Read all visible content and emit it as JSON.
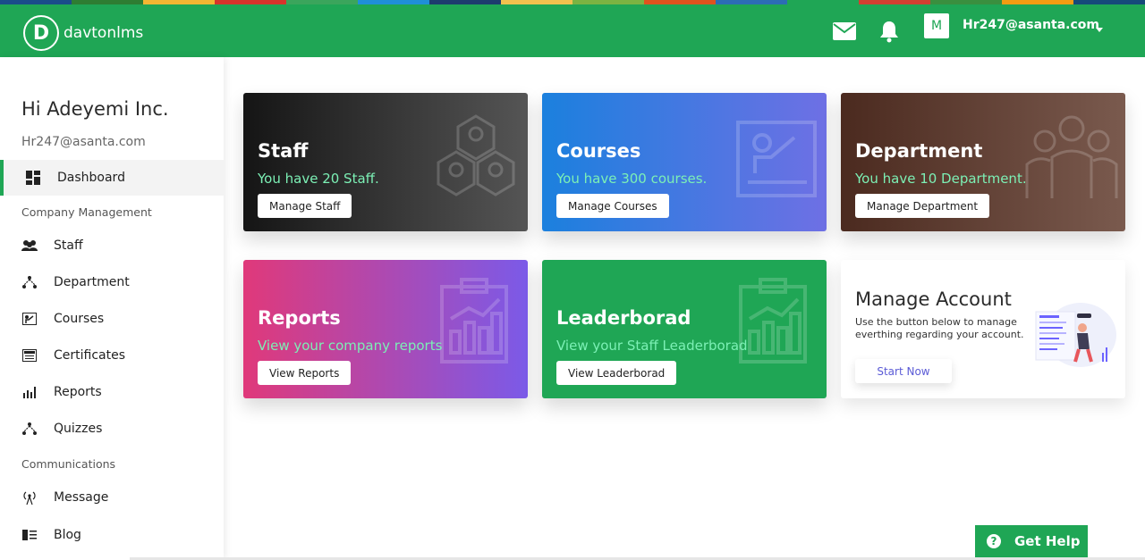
{
  "colors": {
    "brand_green": "#1fa655",
    "stripe": [
      "#1a4c8a",
      "#2e7d32",
      "#f2b632",
      "#d7342b",
      "#3ba55c",
      "#1f8fd8",
      "#1d3c6e",
      "#f2c14e",
      "#7bb342",
      "#e0521e",
      "#2c6db5",
      "#1fa655",
      "#d23f31",
      "#3a8f3f",
      "#f39c12",
      "#164a7a"
    ]
  },
  "header": {
    "logo_letter": "D",
    "logo_text": "davtonlms",
    "icons": [
      "mail-icon",
      "bell-icon"
    ],
    "avatar_letter": "M",
    "user_email": "Hr247@asanta.com"
  },
  "sidebar": {
    "greeting": "Hi Adeyemi Inc.",
    "email": "Hr247@asanta.com",
    "dashboard": {
      "label": "Dashboard",
      "icon": "dashboard-icon"
    },
    "sections": [
      {
        "title": "Company Management",
        "items": [
          {
            "label": "Staff",
            "icon": "users-icon"
          },
          {
            "label": "Department",
            "icon": "hierarchy-icon"
          },
          {
            "label": "Courses",
            "icon": "presentation-icon"
          },
          {
            "label": "Certificates",
            "icon": "certificate-icon"
          },
          {
            "label": "Reports",
            "icon": "bar-chart-icon"
          },
          {
            "label": "Quizzes",
            "icon": "hierarchy-icon"
          }
        ]
      },
      {
        "title": "Communications",
        "items": [
          {
            "label": "Message",
            "icon": "broadcast-icon"
          },
          {
            "label": "Blog",
            "icon": "blog-icon"
          }
        ]
      }
    ]
  },
  "cards": {
    "staff": {
      "title": "Staff",
      "subtitle": "You have 20 Staff.",
      "button": "Manage Staff",
      "icon": "staff-group-icon"
    },
    "courses": {
      "title": "Courses",
      "subtitle": "You have 300 courses.",
      "button": "Manage Courses",
      "icon": "presentation-board-icon"
    },
    "department": {
      "title": "Department",
      "subtitle": "You have 10 Department.",
      "button": "Manage Department",
      "icon": "team-icon"
    },
    "reports": {
      "title": "Reports",
      "subtitle": "View your company reports",
      "button": "View Reports",
      "icon": "clipboard-chart-icon"
    },
    "leaderboard": {
      "title": "Leaderborad",
      "subtitle": "View your Staff Leaderborad",
      "button": "View Leaderborad",
      "icon": "clipboard-chart-icon"
    },
    "account": {
      "title": "Manage Account",
      "description": "Use the button below to manage everthing regarding your account.",
      "button": "Start Now",
      "icon": "account-illustration"
    }
  },
  "help": {
    "label": "Get Help",
    "icon": "question-circle-icon"
  }
}
